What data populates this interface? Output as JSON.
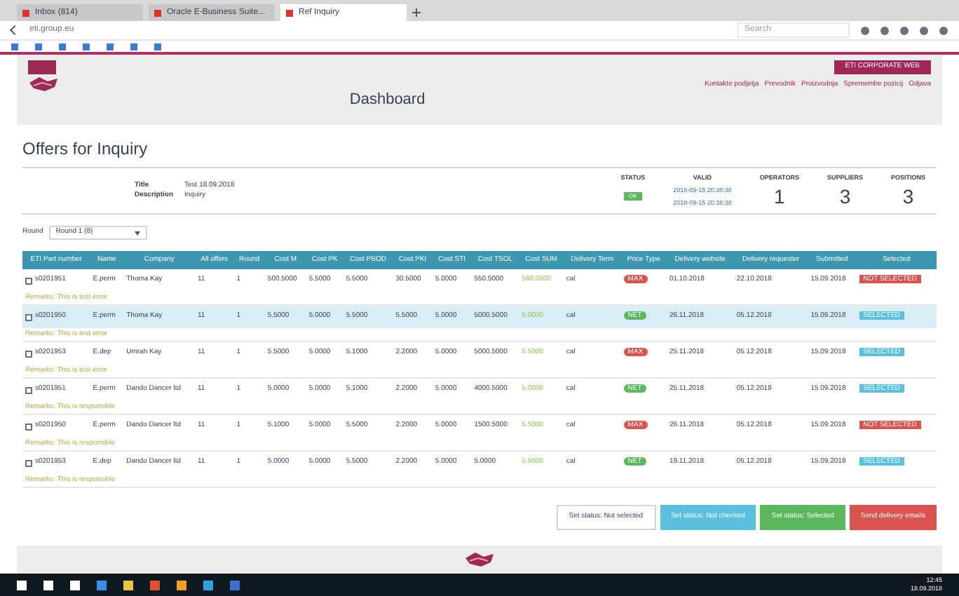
{
  "browser": {
    "tabs": [
      {
        "title": "Inbox (814)",
        "selected": false
      },
      {
        "title": "Oracle E-Business Suite...",
        "selected": false
      },
      {
        "title": "Ref Inquiry",
        "selected": true
      }
    ],
    "url": "eti.group.eu",
    "search": "Search"
  },
  "header": {
    "title": "Dashboard",
    "badge": "ETI CORPORATE WEB",
    "links": [
      "Kontakte podjetja",
      "Prevodnik",
      "Proizvodnja",
      "Spremembe pozicij",
      "Odjava"
    ]
  },
  "page": {
    "title": "Offers for Inquiry"
  },
  "inquiry": {
    "fields": [
      {
        "label": "Title",
        "value": "Test 18.09.2018"
      },
      {
        "label": "Description",
        "value": "Inquiry"
      }
    ],
    "stats": [
      {
        "kind": "status",
        "label": "STATUS",
        "value": "OK"
      },
      {
        "kind": "dates",
        "label": "VALID",
        "lines": [
          "2018-09-15 20:38:38",
          "2018-09-15 20:38:38"
        ]
      },
      {
        "kind": "number",
        "label": "OPERATORS",
        "value": "1"
      },
      {
        "kind": "number",
        "label": "SUPPLIERS",
        "value": "3"
      },
      {
        "kind": "number",
        "label": "POSITIONS",
        "value": "3"
      }
    ]
  },
  "round": {
    "label": "Round",
    "value": "Round 1 (8)"
  },
  "table": {
    "columns": [
      "ETI Part number",
      "Name",
      "Company",
      "All offers",
      "Round",
      "Cost M",
      "Cost PK",
      "Cost PBOD",
      "Cost PKI",
      "Cost STI",
      "Cost TSOL",
      "Cost SUM",
      "Delivery Term",
      "Price Type",
      "Delivery website",
      "Delivery requester",
      "Submitted",
      "Selected"
    ],
    "rows": [
      {
        "checked": false,
        "selected": false,
        "cells": [
          "s0201951",
          "E.perm",
          "Thoma Kay",
          "11",
          "1",
          "500.5000",
          "5.5000",
          "5.5000",
          "30.5000",
          "5.0000",
          "550.5000",
          "560.0000",
          "cal"
        ],
        "price_type": {
          "kind": "bad",
          "label": "MAX"
        },
        "dates": [
          "01.10.2018",
          "22.10.2018",
          "15.09.2018"
        ],
        "status": {
          "kind": "not",
          "label": "NOT SELECTED"
        },
        "remark": "Remarks: This is test error"
      },
      {
        "checked": false,
        "selected": true,
        "cells": [
          "s0201950",
          "E.perm",
          "Thoma Kay",
          "11",
          "1",
          "5.5000",
          "5.0000",
          "5.5000",
          "5.5000",
          "5.0000",
          "5000.5000",
          "5.0000",
          "cal"
        ],
        "price_type": {
          "kind": "good",
          "label": "NET"
        },
        "dates": [
          "26.11.2018",
          "05.12.2018",
          "15.09.2018"
        ],
        "status": {
          "kind": "yes",
          "label": "SELECTED"
        },
        "remark": "Remarks: This is test error"
      },
      {
        "checked": false,
        "selected": false,
        "cells": [
          "s0201953",
          "E.dep",
          "Umrah Kay",
          "11",
          "1",
          "5.5000",
          "5.0000",
          "5.1000",
          "2.2000",
          "5.0000",
          "5000.5000",
          "5.5000",
          "cal"
        ],
        "price_type": {
          "kind": "bad",
          "label": "MAX"
        },
        "dates": [
          "25.11.2018",
          "05.12.2018",
          "15.09.2018"
        ],
        "status": {
          "kind": "yes",
          "label": "SELECTED"
        },
        "remark": "Remarks: This is test error"
      },
      {
        "checked": false,
        "selected": false,
        "cells": [
          "s0201951",
          "E.perm",
          "Dando Dancer ltd",
          "11",
          "1",
          "5.0000",
          "5.0000",
          "5.1000",
          "2.2000",
          "5.0000",
          "4000.5000",
          "5.0000",
          "cal"
        ],
        "price_type": {
          "kind": "good",
          "label": "NET"
        },
        "dates": [
          "25.11.2018",
          "05.12.2018",
          "15.09.2018"
        ],
        "status": {
          "kind": "yes",
          "label": "SELECTED"
        },
        "remark": "Remarks: This is responsible"
      },
      {
        "checked": false,
        "selected": false,
        "cells": [
          "s0201950",
          "E.perm",
          "Dando Dancer ltd",
          "11",
          "1",
          "5.1000",
          "5.0000",
          "5.5000",
          "2.2000",
          "5.0000",
          "1500.5000",
          "5.5000",
          "cal"
        ],
        "price_type": {
          "kind": "bad",
          "label": "MAX"
        },
        "dates": [
          "26.11.2018",
          "05.12.2018",
          "15.09.2018"
        ],
        "status": {
          "kind": "not",
          "label": "NOT SELECTED"
        },
        "remark": "Remarks: This is responsible"
      },
      {
        "checked": false,
        "selected": false,
        "cells": [
          "s0201953",
          "E.dep",
          "Dando Dancer ltd",
          "11",
          "1",
          "5.0000",
          "5.0000",
          "5.5000",
          "2.2000",
          "5.0000",
          "5.0000",
          "5.5000",
          "cal"
        ],
        "price_type": {
          "kind": "good",
          "label": "NET"
        },
        "dates": [
          "19.11.2018",
          "05.12.2018",
          "15.09.2018"
        ],
        "status": {
          "kind": "yes",
          "label": "SELECTED"
        },
        "remark": "Remarks: This is responsible"
      }
    ]
  },
  "actions": [
    {
      "kind": "plain",
      "label": "Set status: Not selected"
    },
    {
      "kind": "info",
      "label": "Set status: Not checked"
    },
    {
      "kind": "success",
      "label": "Set status: Selected"
    },
    {
      "kind": "danger",
      "label": "Send delivery emails"
    }
  ],
  "taskbar": {
    "time": "12:45",
    "date": "18.09.2018"
  }
}
